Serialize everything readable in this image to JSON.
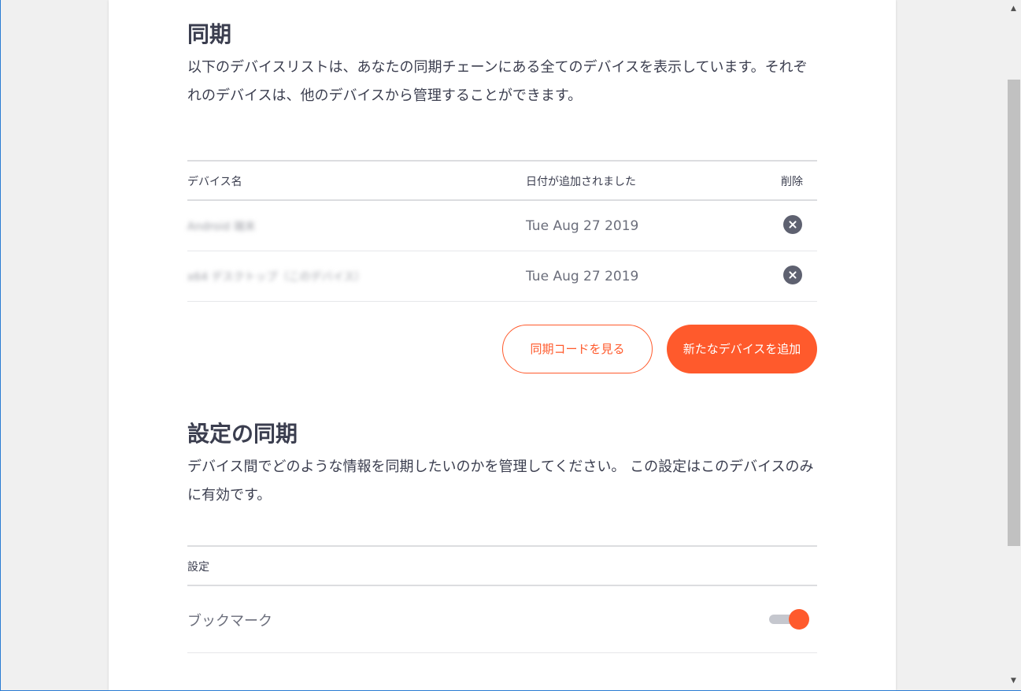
{
  "sync": {
    "title": "同期",
    "description": "以下のデバイスリストは、あなたの同期チェーンにある全てのデバイスを表示しています。それぞれのデバイスは、他のデバイスから管理することができます。",
    "table": {
      "headers": {
        "device_name": "デバイス名",
        "date_added": "日付が追加されました",
        "remove": "削除"
      },
      "rows": [
        {
          "device_name": "Android 端末",
          "date_added": "Tue Aug 27 2019"
        },
        {
          "device_name": "x64 デスクトップ（このデバイス）",
          "date_added": "Tue Aug 27 2019"
        }
      ]
    },
    "buttons": {
      "view_code": "同期コードを見る",
      "add_device": "新たなデバイスを追加"
    }
  },
  "settings_sync": {
    "title": "設定の同期",
    "description": "デバイス間でどのような情報を同期したいのかを管理してください。 この設定はこのデバイスのみに有効です。",
    "table": {
      "header": "設定",
      "rows": [
        {
          "label": "ブックマーク",
          "enabled": true
        }
      ]
    }
  },
  "colors": {
    "accent": "#ff5a2c",
    "text": "#3b3e4f",
    "muted_text": "#6b6e7b",
    "remove_icon": "#5e6170"
  },
  "icons": {
    "remove": "close-circle-icon",
    "scroll_up": "arrow-up-icon",
    "scroll_down": "arrow-down-icon"
  }
}
